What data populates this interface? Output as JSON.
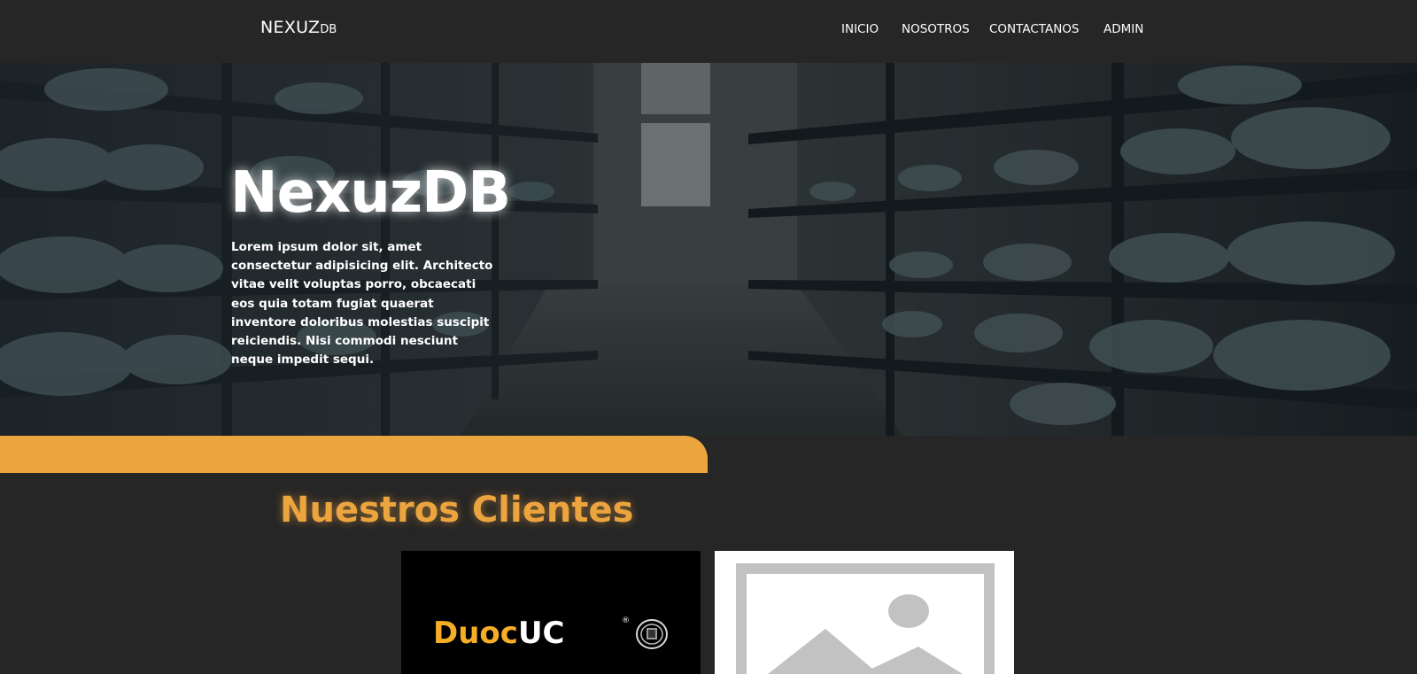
{
  "navbar": {
    "brand_main": "NEXUZ",
    "brand_sub": "DB",
    "links": [
      {
        "label": "INICIO"
      },
      {
        "label": "NOSOTROS"
      },
      {
        "label": "CONTACTANOS"
      },
      {
        "label": "ADMIN"
      }
    ]
  },
  "hero": {
    "title": "NexuzDB",
    "text": "Lorem ipsum dolor sit, amet consectetur adipisicing elit. Architecto vitae velit voluptas porro, obcaecati eos quia totam fugiat quaerat inventore doloribus molestias suscipit reiciendis. Nisi commodi nesciunt neque impedit sequi."
  },
  "clients": {
    "title": "Nuestros Clientes",
    "items": [
      {
        "logo_text_1": "Duoc",
        "logo_text_2": "UC",
        "reg_mark": "®",
        "icon": "duoc-uc-seal"
      },
      {
        "icon": "image-placeholder-icon"
      }
    ]
  },
  "colors": {
    "background": "#262626",
    "accent": "#eca43f",
    "hero_tint": "#2c3538"
  }
}
